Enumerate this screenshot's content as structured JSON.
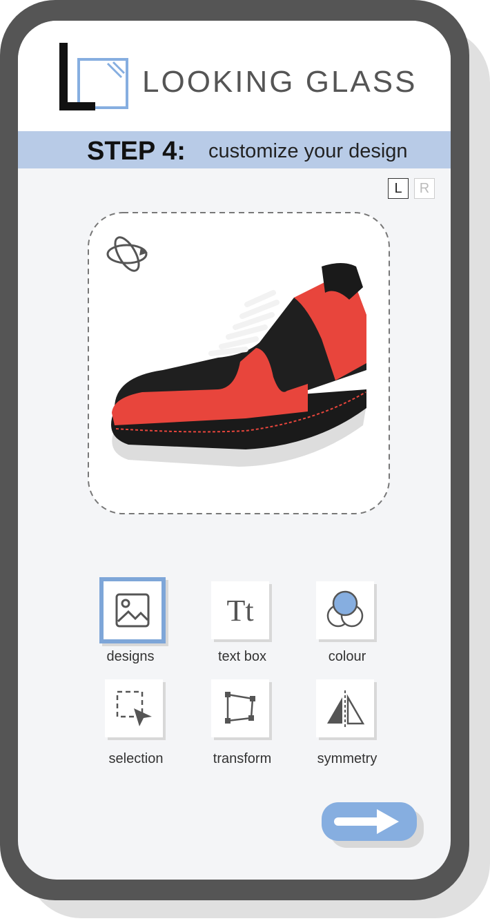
{
  "app": {
    "brand_name": "LOOKING GLASS",
    "logo_letter": "L",
    "accent_color": "#86aee0",
    "dark_color": "#555555"
  },
  "step": {
    "label": "STEP 4:",
    "title": "customize your design"
  },
  "shoe_side": {
    "left": "L",
    "right": "R",
    "selected": "L"
  },
  "preview": {
    "rotate_icon": "rotate-3d-icon",
    "image": "sneaker-black-red"
  },
  "tools": [
    {
      "label": "designs",
      "icon": "image-icon",
      "selected": true
    },
    {
      "label": "text box",
      "icon": "text-tt-icon",
      "glyph": "Tt",
      "selected": false
    },
    {
      "label": "colour",
      "icon": "color-circles-icon",
      "selected": false
    },
    {
      "label": "selection",
      "icon": "selection-cursor-icon",
      "selected": false
    },
    {
      "label": "transform",
      "icon": "transform-icon",
      "selected": false
    },
    {
      "label": "symmetry",
      "icon": "symmetry-icon",
      "selected": false
    }
  ],
  "next_button": {
    "icon": "arrow-right-icon"
  }
}
